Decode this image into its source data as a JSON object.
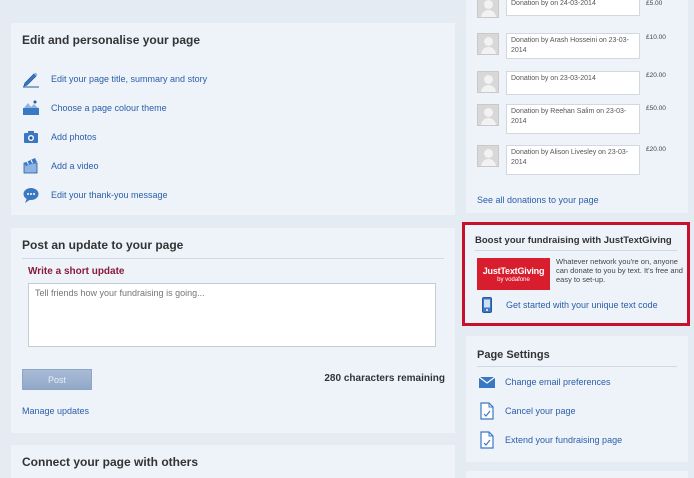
{
  "edit_panel": {
    "title": "Edit and personalise your page",
    "items": [
      {
        "label": "Edit your page title, summary and story",
        "icon": "pencil-icon"
      },
      {
        "label": "Choose a page colour theme",
        "icon": "palette-icon"
      },
      {
        "label": "Add photos",
        "icon": "camera-icon"
      },
      {
        "label": "Add a video",
        "icon": "video-icon"
      },
      {
        "label": "Edit your thank-you message",
        "icon": "speech-bubble-icon"
      }
    ]
  },
  "post_panel": {
    "title": "Post an update to your page",
    "write_label": "Write a short update",
    "placeholder": "Tell friends how your fundraising is going...",
    "post_button": "Post",
    "chars_remaining": "280 characters remaining",
    "manage_link": "Manage updates"
  },
  "connect_panel": {
    "title": "Connect your page with others"
  },
  "donations": {
    "items": [
      {
        "text": "Donation by on 24-03-2014",
        "amount": "£5.00"
      },
      {
        "text": "Donation by Arash Hosseini on 23-03-2014",
        "amount": "£10.00"
      },
      {
        "text": "Donation by on 23-03-2014",
        "amount": "£20.00"
      },
      {
        "text": "Donation by Reehan Salim on 23-03-2014",
        "amount": "£50.00"
      },
      {
        "text": "Donation by Alison Livesley on 23-03-2014",
        "amount": "£20.00"
      }
    ],
    "see_all": "See all donations to your page"
  },
  "boost_panel": {
    "title": "Boost your fundraising with JustTextGiving",
    "logo_line1": "JustTextGiving",
    "logo_line2": "by vodafone",
    "description": "Whatever network you're on, anyone can donate to you by text. It's free and easy to set-up.",
    "start_link": "Get started with your unique text code",
    "highlight_color": "#c8102e"
  },
  "settings_panel": {
    "title": "Page Settings",
    "items": [
      {
        "label": "Change email preferences",
        "icon": "envelope-icon"
      },
      {
        "label": "Cancel your page",
        "icon": "document-icon"
      },
      {
        "label": "Extend your fundraising page",
        "icon": "document-icon"
      }
    ]
  }
}
